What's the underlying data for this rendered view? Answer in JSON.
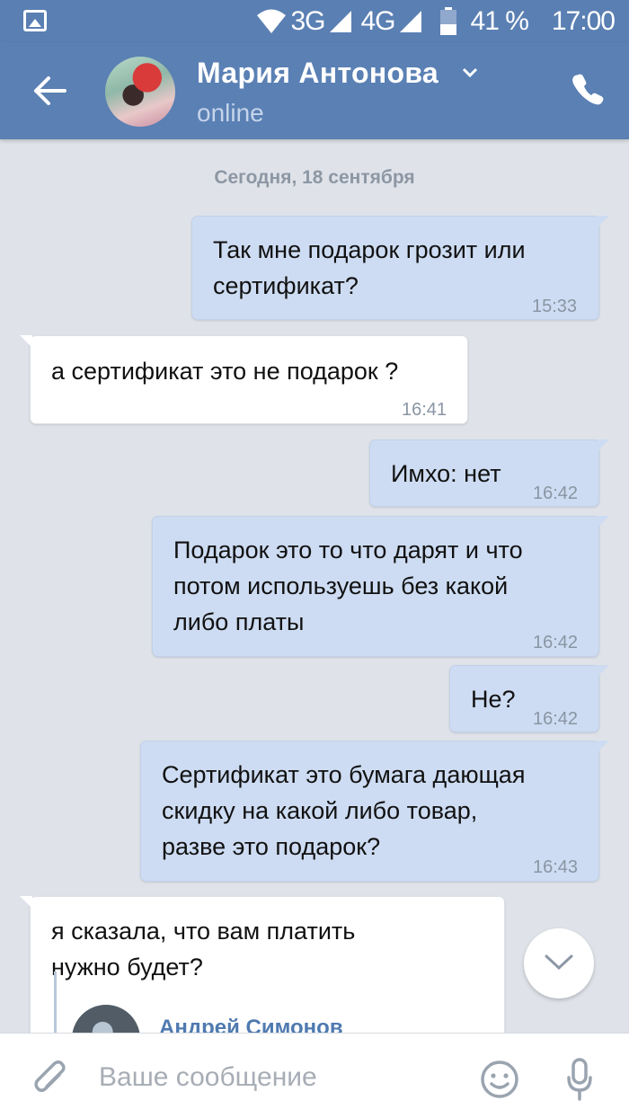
{
  "status_bar": {
    "network_3g": "3G",
    "network_4g": "4G",
    "battery": "41 %",
    "time": "17:00"
  },
  "header": {
    "name": "Мария Антонова",
    "status": "online"
  },
  "chat": {
    "date_label": "Сегодня, 18 сентября",
    "messages": [
      {
        "direction": "out",
        "text": "Так мне подарок грозит или\nсертификат?",
        "time": "15:33"
      },
      {
        "direction": "in",
        "text": "а сертификат это не подарок ?",
        "time": "16:41"
      },
      {
        "direction": "out",
        "text": "Имхо: нет",
        "time": "16:42"
      },
      {
        "direction": "out",
        "text": "Подарок это то что дарят и что\nпотом используешь без какой\nлибо платы",
        "time": "16:42"
      },
      {
        "direction": "out",
        "text": "Не?",
        "time": "16:42"
      },
      {
        "direction": "out",
        "text": "Сертификат это бумага дающая\nскидку на какой либо товар,\nразве это подарок?",
        "time": "16:43"
      },
      {
        "direction": "in",
        "text": "я сказала, что вам платить\nнужно будет?",
        "quoted_author": "Андрей Симонов"
      }
    ]
  },
  "composer": {
    "placeholder": "Ваше сообщение"
  },
  "colors": {
    "header": "#5a80b4",
    "outgoing_bubble": "#cddcf2",
    "incoming_bubble": "#ffffff",
    "chat_background": "#dfe3e9",
    "link_accent": "#4f7ab0"
  },
  "icons": [
    "gallery-icon",
    "wifi-icon",
    "signal-icon",
    "battery-icon",
    "back-arrow-icon",
    "chevron-down-icon",
    "phone-icon",
    "scroll-down-chevron-icon",
    "paperclip-icon",
    "emoji-icon",
    "microphone-icon"
  ]
}
